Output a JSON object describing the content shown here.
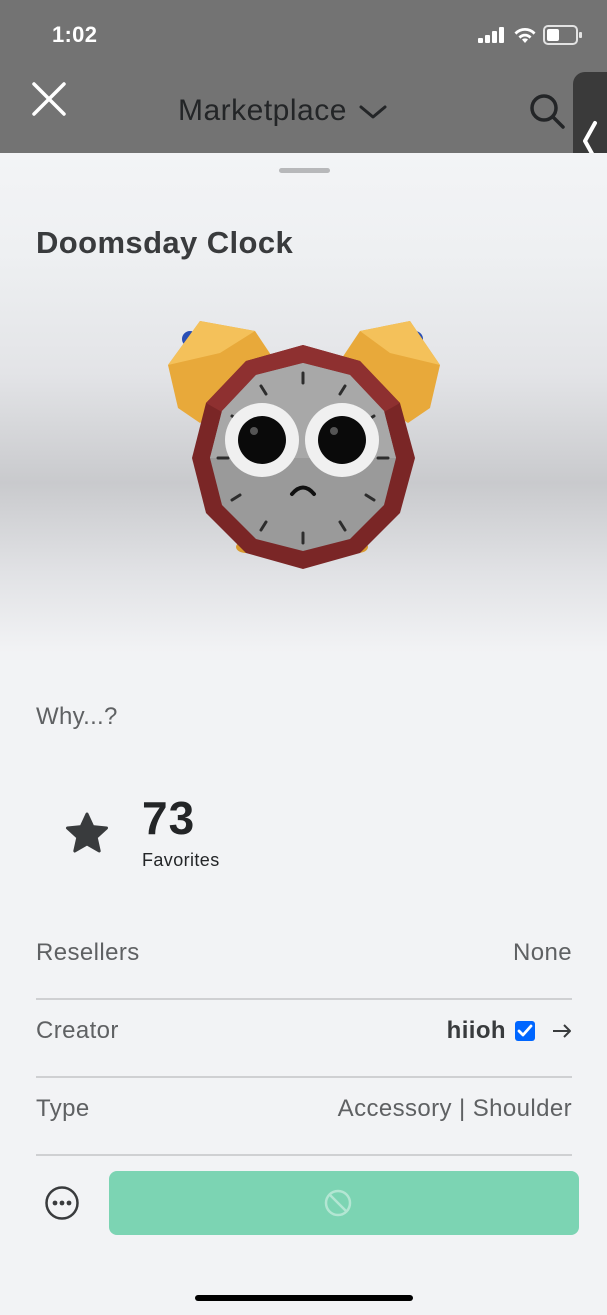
{
  "status_bar": {
    "time": "1:02"
  },
  "nav": {
    "title": "Marketplace"
  },
  "item": {
    "title": "Doomsday Clock",
    "description": "Why...?",
    "favorites": {
      "count": "73",
      "label": "Favorites"
    }
  },
  "details": {
    "resellers": {
      "label": "Resellers",
      "value": "None"
    },
    "creator": {
      "label": "Creator",
      "name": "hiioh"
    },
    "type": {
      "label": "Type",
      "value": "Accessory | Shoulder"
    }
  },
  "colors": {
    "header": "#737373",
    "buy_button": "#7cd4b3",
    "verified_badge": "#0066ff",
    "clock_rim": "#7a2626",
    "clock_bells": "#e8a93a"
  },
  "icons": {
    "close": "close-icon",
    "dropdown": "chevron-down-icon",
    "search": "search-icon",
    "side_tab": "chevron-left-icon",
    "favorite": "star-icon",
    "verified": "verified-badge-icon",
    "creator_link": "arrow-right-icon",
    "more": "more-options-icon",
    "buy_disabled": "not-allowed-icon"
  }
}
